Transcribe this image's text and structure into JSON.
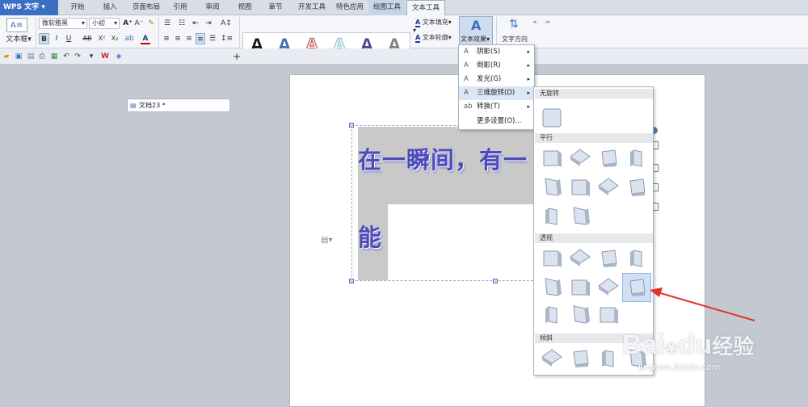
{
  "app": {
    "logo": "WPS 文字"
  },
  "tabs": [
    "开始",
    "插入",
    "页面布局",
    "引用",
    "审阅",
    "视图",
    "章节",
    "开发工具",
    "特色应用",
    "绘图工具",
    "文本工具"
  ],
  "ribbon": {
    "textbox": "文本框",
    "font_name": "微软雅黑",
    "font_size": "小初",
    "fill": "文本填充",
    "outline": "文本轮廓",
    "effects": "文本效果",
    "direction": "文字方向",
    "style_letter": "A",
    "style_colors": [
      "#111111",
      "#3c6fb5",
      "#c0504d",
      "#8fc2c7",
      "#4f3f8f",
      "#7f7f7f"
    ]
  },
  "doc": {
    "tab": "文档23 *"
  },
  "page": {
    "line1": "在一瞬间，有一",
    "line2": "能"
  },
  "menu": {
    "items": [
      {
        "label": "阴影(S)",
        "arrow": "▸"
      },
      {
        "label": "倒影(R)",
        "arrow": "▸"
      },
      {
        "label": "发光(G)",
        "arrow": "▸"
      },
      {
        "label": "三维旋转(D)",
        "arrow": "▸"
      },
      {
        "label": "转换(T)",
        "arrow": "▸"
      },
      {
        "label": "更多设置(O)...",
        "arrow": ""
      }
    ]
  },
  "submenu": {
    "headers": [
      "无旋转",
      "平行",
      "透视",
      "倾斜"
    ]
  },
  "watermark": {
    "brand": "Bai",
    "paw": "du",
    "suffix": "经验",
    "url": "jingyan.baidu.com"
  }
}
